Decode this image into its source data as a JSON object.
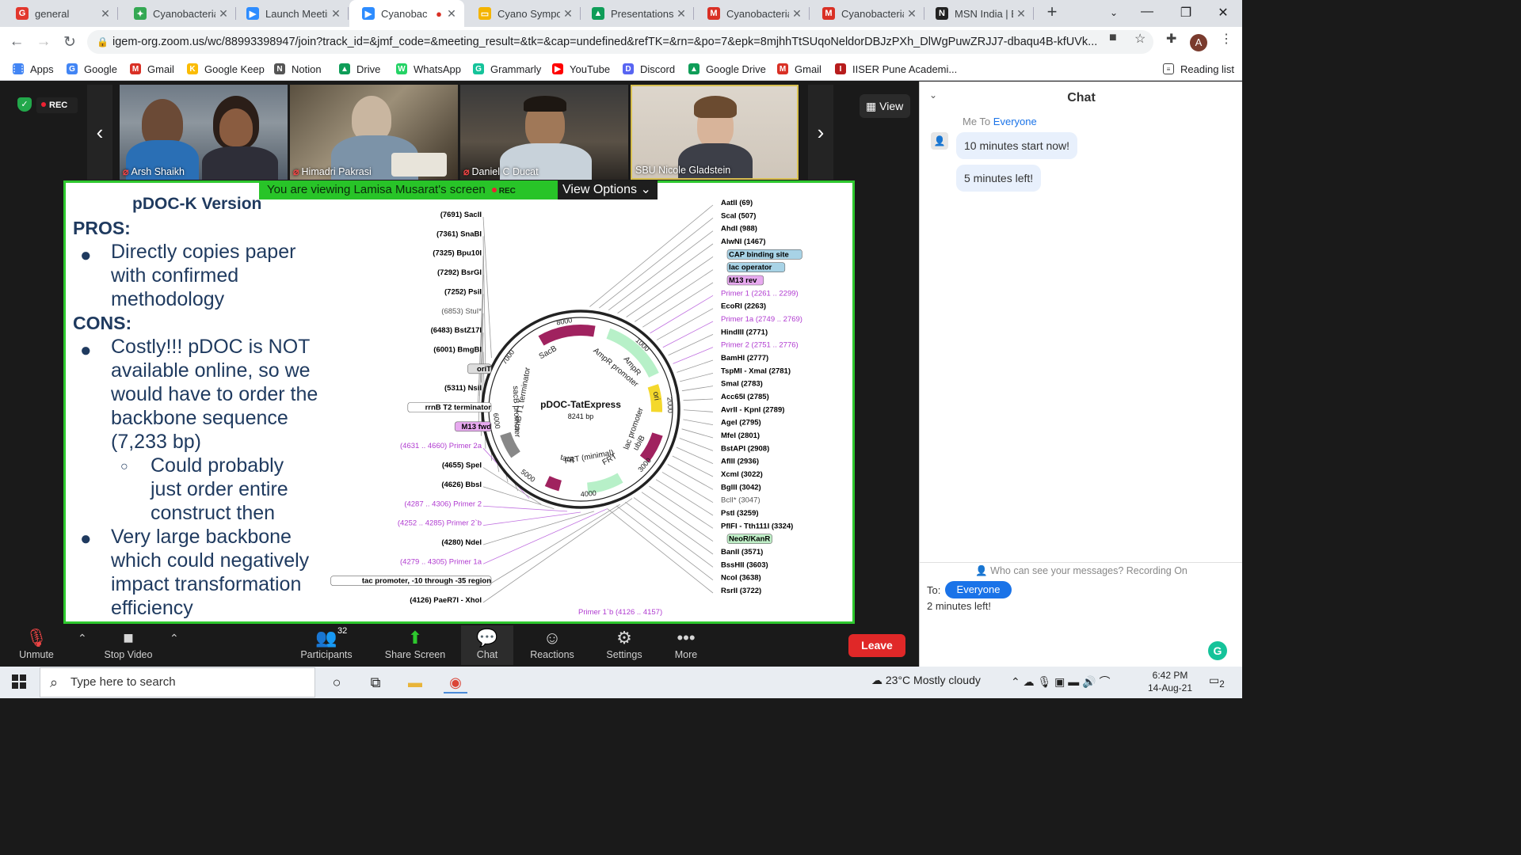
{
  "browser": {
    "tabs": [
      {
        "title": "general",
        "icon": "G",
        "color": "#e2372d",
        "active": false
      },
      {
        "title": "Cyanobacteria",
        "icon": "✦",
        "color": "#34a853",
        "active": false
      },
      {
        "title": "Launch Meetin",
        "icon": "▶",
        "color": "#2d8cff",
        "active": false
      },
      {
        "title": "Cyanobac",
        "icon": "▶",
        "color": "#2d8cff",
        "active": true
      },
      {
        "title": "Cyano Sympos",
        "icon": "▭",
        "color": "#f4b400",
        "active": false
      },
      {
        "title": "Presentations",
        "icon": "▲",
        "color": "#0f9d58",
        "active": false
      },
      {
        "title": "Cyanobacteria",
        "icon": "M",
        "color": "#d93025",
        "active": false
      },
      {
        "title": "Cyanobacteria",
        "icon": "M",
        "color": "#d93025",
        "active": false
      },
      {
        "title": "MSN India | Br",
        "icon": "N",
        "color": "#222222",
        "active": false
      }
    ],
    "url": "igem-org.zoom.us/wc/88993398947/join?track_id=&jmf_code=&meeting_result=&tk=&cap=undefined&refTK=&rn=&po=7&epk=8mjhhTtSUqoNeldorDBJzPXh_DlWgPuwZRJJ7-dbaqu4B-kfUVk...",
    "avatar": "A",
    "bookmarks": [
      {
        "label": "Apps",
        "icon": "⋮⋮",
        "color": "#4285f4"
      },
      {
        "label": "Google",
        "icon": "G",
        "color": "#4285f4"
      },
      {
        "label": "Gmail",
        "icon": "M",
        "color": "#d93025"
      },
      {
        "label": "Google Keep",
        "icon": "K",
        "color": "#fbbc04"
      },
      {
        "label": "Notion",
        "icon": "N",
        "color": "#555555"
      },
      {
        "label": "Drive",
        "icon": "▲",
        "color": "#0f9d58"
      },
      {
        "label": "WhatsApp",
        "icon": "W",
        "color": "#25d366"
      },
      {
        "label": "Grammarly",
        "icon": "G",
        "color": "#15c39a"
      },
      {
        "label": "YouTube",
        "icon": "▶",
        "color": "#ff0000"
      },
      {
        "label": "Discord",
        "icon": "D",
        "color": "#5865f2"
      },
      {
        "label": "Google Drive",
        "icon": "▲",
        "color": "#0f9d58"
      },
      {
        "label": "Gmail",
        "icon": "M",
        "color": "#d93025"
      },
      {
        "label": "IISER Pune Academi...",
        "icon": "I",
        "color": "#b71c1c"
      }
    ],
    "reading_list": "Reading list"
  },
  "zoom": {
    "rec": "REC",
    "view_label": "View",
    "participants": [
      {
        "name": "Arsh Shaikh",
        "muted": true
      },
      {
        "name": "Himadri Pakrasi",
        "muted": true
      },
      {
        "name": "Daniel C Ducat",
        "muted": true
      },
      {
        "name": "SBU Nicole Gladstein",
        "muted": false
      }
    ],
    "banner": "You are viewing Lamisa Musarat's screen",
    "banner_rec": "REC",
    "view_options": "View Options",
    "controls": {
      "unmute": "Unmute",
      "stop_video": "Stop Video",
      "participants": "Participants",
      "participants_count": "32",
      "share_screen": "Share Screen",
      "chat": "Chat",
      "reactions": "Reactions",
      "settings": "Settings",
      "more": "More",
      "leave": "Leave"
    }
  },
  "slide": {
    "title": "pDOC-K Version",
    "pros_heading": "PROS:",
    "pros": [
      "Directly copies paper with confirmed methodology"
    ],
    "cons_heading": "CONS:",
    "cons": [
      "Costly!!! pDOC is NOT available online, so we would have to order the backbone sequence (7,233 bp)",
      "Could probably just order entire construct then",
      "Very large backbone which could negatively impact transformation efficiency"
    ]
  },
  "plasmid": {
    "name": "pDOC-TatExpress",
    "size": "8241 bp",
    "ticks": [
      "1000",
      "2000",
      "3000",
      "4000",
      "5000",
      "6000",
      "7000",
      "8000"
    ],
    "features": [
      "AmpR",
      "AmpR promoter",
      "ori",
      "lac promoter",
      "ubiB",
      "FRT",
      "FRT (minimal)",
      "tatA",
      "rrnB T1 terminator",
      "sacB promoter",
      "SacB"
    ],
    "left_labels": [
      {
        "t": "(7691)  SacII",
        "c": "#000"
      },
      {
        "t": "(7361)  SnaBI",
        "c": "#000"
      },
      {
        "t": "(7325)  Bpu10I",
        "c": "#000"
      },
      {
        "t": "(7292)  BsrGI",
        "c": "#000"
      },
      {
        "t": "(7252)  PsiI",
        "c": "#000"
      },
      {
        "t": "(6853)  StuI*",
        "c": "#555"
      },
      {
        "t": "(6483)  BstZ17I",
        "c": "#000"
      },
      {
        "t": "(6001)  BmgBI",
        "c": "#000"
      },
      {
        "t": "oriT",
        "c": "#000",
        "box": "#ddd"
      },
      {
        "t": "(5311)  NsiI",
        "c": "#000"
      },
      {
        "t": "rrnB T2 terminator",
        "c": "#000",
        "box": "#fff"
      },
      {
        "t": "M13 fwd",
        "c": "#000",
        "box": "#e7a9ef"
      },
      {
        "t": "(4631 .. 4660)  Primer 2a",
        "c": "#b03bd0"
      },
      {
        "t": "(4655)  SpeI",
        "c": "#000"
      },
      {
        "t": "(4626)  BbsI",
        "c": "#000"
      },
      {
        "t": "(4287 .. 4306)  Primer 2",
        "c": "#b03bd0"
      },
      {
        "t": "(4252 .. 4285)  Primer 2`b",
        "c": "#b03bd0"
      },
      {
        "t": "(4280)  NdeI",
        "c": "#000"
      },
      {
        "t": "(4279 .. 4305)  Primer 1a",
        "c": "#b03bd0"
      },
      {
        "t": "tac promoter, -10 through -35 region",
        "c": "#000",
        "box": "#fff"
      },
      {
        "t": "(4126)  PaeR7I - XhoI",
        "c": "#000"
      }
    ],
    "right_labels": [
      {
        "t": "AatII  (69)",
        "c": "#000"
      },
      {
        "t": "ScaI  (507)",
        "c": "#000"
      },
      {
        "t": "AhdI  (988)",
        "c": "#000"
      },
      {
        "t": "AlwNI  (1467)",
        "c": "#000"
      },
      {
        "t": "CAP binding site",
        "c": "#000",
        "box": "#a8d3e6"
      },
      {
        "t": "lac operator",
        "c": "#000",
        "box": "#a8d3e6"
      },
      {
        "t": "M13 rev",
        "c": "#000",
        "box": "#e7a9ef"
      },
      {
        "t": "Primer 1  (2261 .. 2299)",
        "c": "#b03bd0"
      },
      {
        "t": "EcoRI  (2263)",
        "c": "#000"
      },
      {
        "t": "Primer 1a  (2749 .. 2769)",
        "c": "#b03bd0"
      },
      {
        "t": "HindIII  (2771)",
        "c": "#000"
      },
      {
        "t": "Primer 2  (2751 .. 2776)",
        "c": "#b03bd0"
      },
      {
        "t": "BamHI  (2777)",
        "c": "#000"
      },
      {
        "t": "TspMI - XmaI  (2781)",
        "c": "#000"
      },
      {
        "t": "SmaI  (2783)",
        "c": "#000"
      },
      {
        "t": "Acc65I  (2785)",
        "c": "#000"
      },
      {
        "t": "AvrII - KpnI  (2789)",
        "c": "#000"
      },
      {
        "t": "AgeI  (2795)",
        "c": "#000"
      },
      {
        "t": "MfeI  (2801)",
        "c": "#000"
      },
      {
        "t": "BstAPI  (2908)",
        "c": "#000"
      },
      {
        "t": "AflII  (2936)",
        "c": "#000"
      },
      {
        "t": "XcmI  (3022)",
        "c": "#000"
      },
      {
        "t": "BglII  (3042)",
        "c": "#000"
      },
      {
        "t": "BclI*  (3047)",
        "c": "#555"
      },
      {
        "t": "PstI  (3259)",
        "c": "#000"
      },
      {
        "t": "PflFI - Tth111I  (3324)",
        "c": "#000"
      },
      {
        "t": "NeoR/KanR",
        "c": "#000",
        "box": "#bfeec7"
      },
      {
        "t": "BanII  (3571)",
        "c": "#000"
      },
      {
        "t": "BssHII  (3603)",
        "c": "#000"
      },
      {
        "t": "NcoI  (3638)",
        "c": "#000"
      },
      {
        "t": "RsrII  (3722)",
        "c": "#000"
      }
    ],
    "bottom_label": {
      "t": "Primer 1`b  (4126 .. 4157)",
      "c": "#b03bd0"
    }
  },
  "chat": {
    "title": "Chat",
    "meta_from": "Me To",
    "meta_to": "Everyone",
    "messages": [
      "10 minutes start now!",
      "5 minutes left!"
    ],
    "who_can_see": "Who can see your messages? Recording On",
    "to_label": "To:",
    "to_value": "Everyone",
    "draft": "2 minutes left!"
  },
  "taskbar": {
    "search_placeholder": "Type here to search",
    "weather": "23°C  Mostly cloudy",
    "time": "6:42 PM",
    "date": "14-Aug-21",
    "notifications": "2"
  }
}
